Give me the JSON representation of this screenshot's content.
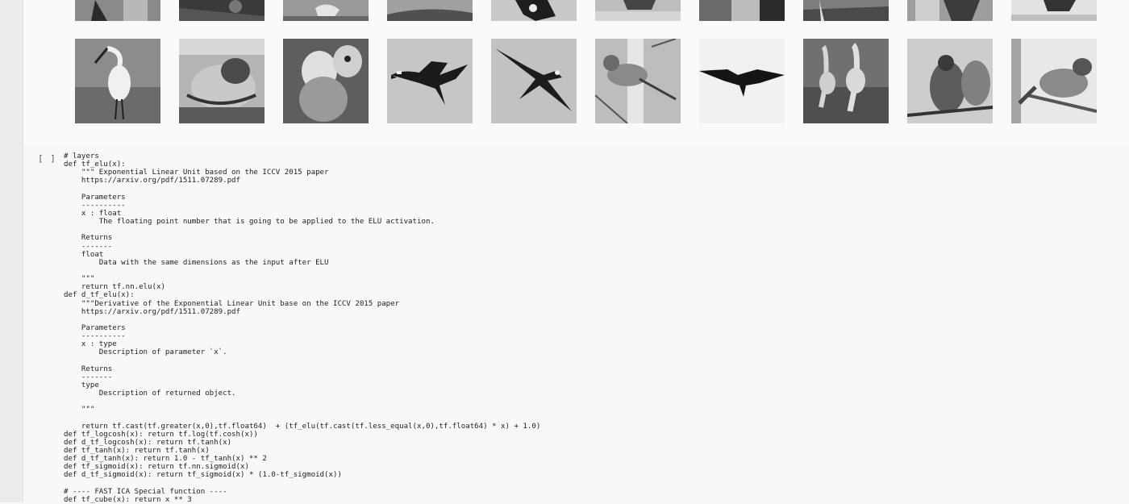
{
  "cell": {
    "prompt": "[ ]",
    "code_lines": [
      "# layers",
      "def tf_elu(x):",
      "    \"\"\" Exponential Linear Unit based on the ICCV 2015 paper",
      "    https://arxiv.org/pdf/1511.07289.pdf",
      "",
      "    Parameters",
      "    ----------",
      "    x : float",
      "        The floating point number that is going to be applied to the ELU activation.",
      "",
      "    Returns",
      "    -------",
      "    float",
      "        Data with the same dimensions as the input after ELU",
      "",
      "    \"\"\"",
      "    return tf.nn.elu(x)",
      "def d_tf_elu(x):",
      "    \"\"\"Derivative of the Exponential Linear Unit base on the ICCV 2015 paper",
      "    https://arxiv.org/pdf/1511.07289.pdf",
      "",
      "    Parameters",
      "    ----------",
      "    x : type",
      "        Description of parameter `x`.",
      "",
      "    Returns",
      "    -------",
      "    type",
      "        Description of returned object.",
      "",
      "    \"\"\"",
      "",
      "    return tf.cast(tf.greater(x,0),tf.float64)  + (tf_elu(tf.cast(tf.less_equal(x,0),tf.float64) * x) + 1.0)",
      "def tf_logcosh(x): return tf.log(tf.cosh(x))",
      "def d_tf_logcosh(x): return tf.tanh(x)",
      "def tf_tanh(x): return tf.tanh(x)",
      "def d_tf_tanh(x): return 1.0 - tf_tanh(x) ** 2",
      "def tf_sigmoid(x): return tf.nn.sigmoid(x)",
      "def d_tf_sigmoid(x): return tf_sigmoid(x) * (1.0-tf_sigmoid(x))",
      "",
      "# ---- FAST ICA Special function ----",
      "def tf_cube(x): return x ** 3"
    ]
  },
  "output_images": {
    "top_row": [
      "bird-image",
      "bird-image",
      "bird-image",
      "bird-image",
      "bird-image",
      "bird-image",
      "bird-image",
      "bird-image",
      "bird-image",
      "bird-image"
    ],
    "bottom_row": [
      "spoonbill-image",
      "parrot-image",
      "parrot-image",
      "goose-image",
      "swallow-image",
      "warbler-image",
      "kite-image",
      "crane-image",
      "pigeon-image",
      "finch-image"
    ]
  }
}
